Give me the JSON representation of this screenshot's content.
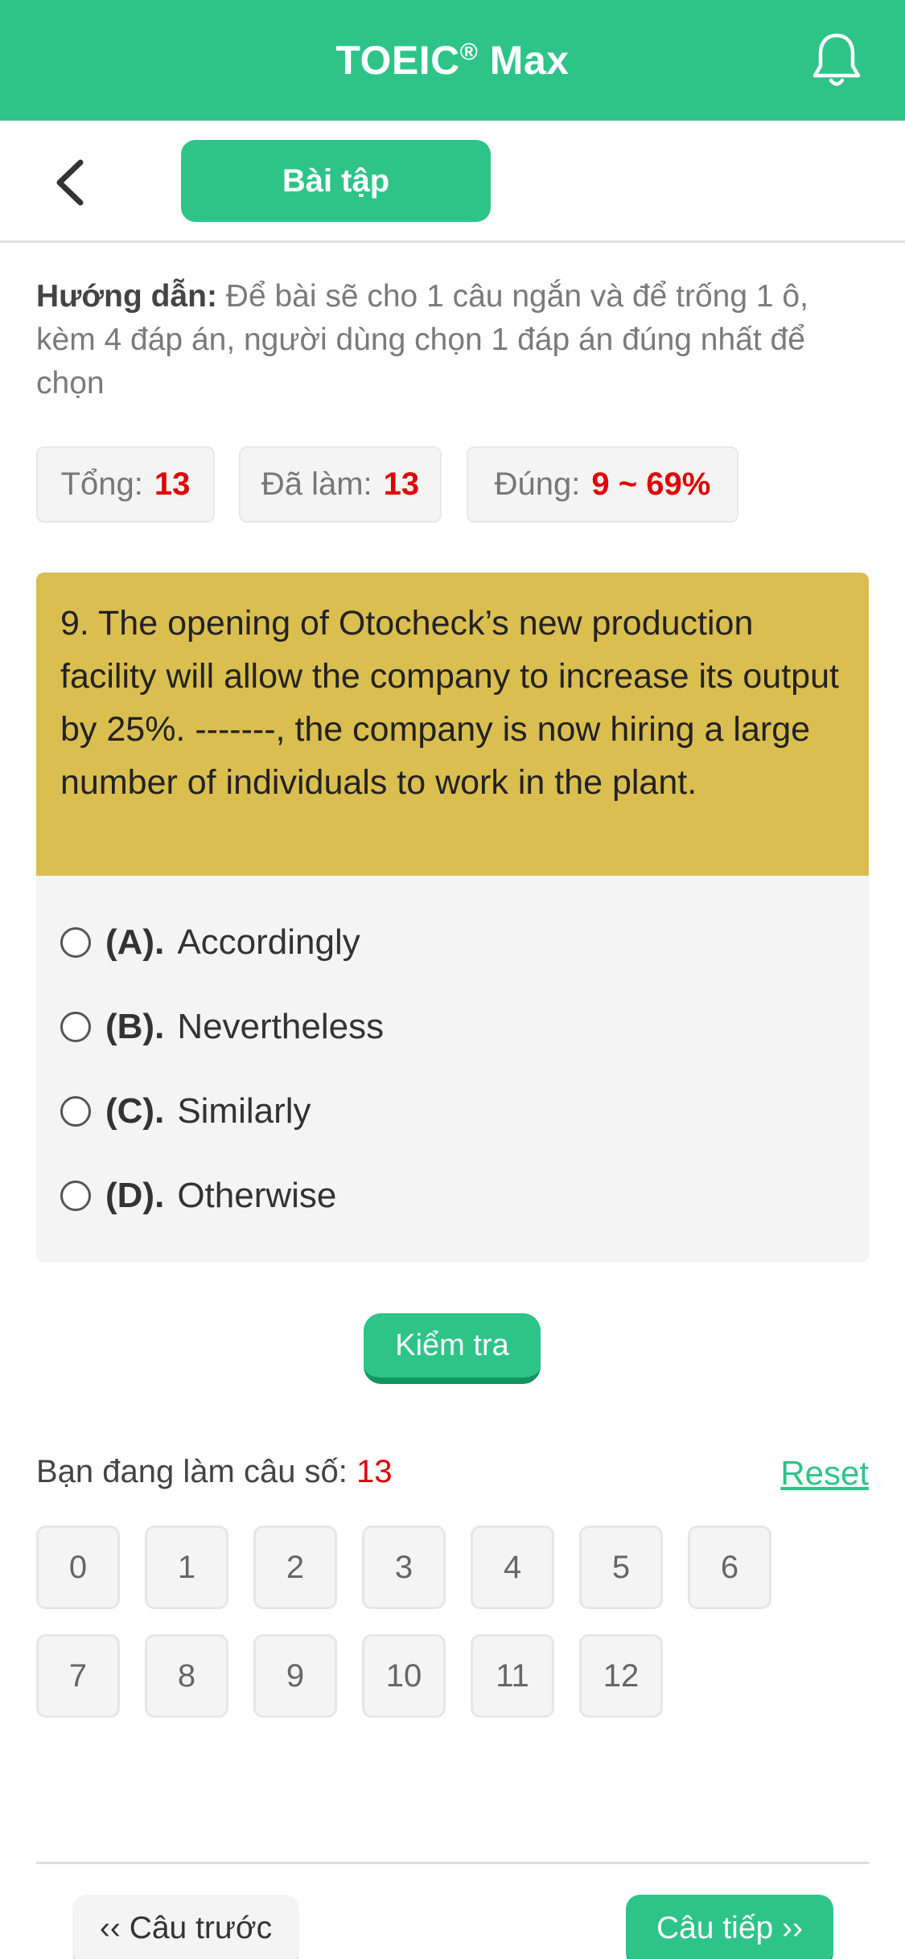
{
  "header": {
    "title": "TOEIC",
    "title_mark": "®",
    "title_suffix": " Max"
  },
  "subbar": {
    "tab_label": "Bài tập"
  },
  "instruction": {
    "label": "Hướng dẫn:",
    "text": " Để bài sẽ cho 1 câu ngắn và để trống 1 ô, kèm 4 đáp án, người dùng chọn 1 đáp án đúng nhất để chọn"
  },
  "stats": {
    "total_label": "Tổng:",
    "total_value": "13",
    "done_label": "Đã làm:",
    "done_value": "13",
    "correct_label": "Đúng:",
    "correct_value": "9 ~ 69%"
  },
  "question": {
    "text": "9. The opening of Otocheck’s new production facility will allow the company to increase its output by 25%. -------, the company is now hiring a large number of individuals to work in the plant.",
    "options": [
      {
        "letter": "(A).",
        "text": "Accordingly"
      },
      {
        "letter": "(B).",
        "text": "Nevertheless"
      },
      {
        "letter": "(C).",
        "text": "Similarly"
      },
      {
        "letter": "(D).",
        "text": "Otherwise"
      }
    ]
  },
  "check_button": "Kiểm tra",
  "progress": {
    "label": "Bạn đang làm câu số: ",
    "current": "13",
    "reset_label": "Reset"
  },
  "question_numbers": [
    "0",
    "1",
    "2",
    "3",
    "4",
    "5",
    "6",
    "7",
    "8",
    "9",
    "10",
    "11",
    "12"
  ],
  "footer": {
    "prev_label": "‹‹ Câu trước",
    "next_label": "Câu tiếp ››"
  },
  "colors": {
    "brand": "#2ec488",
    "question_bg": "#dabe4f",
    "highlight": "#e00000"
  }
}
